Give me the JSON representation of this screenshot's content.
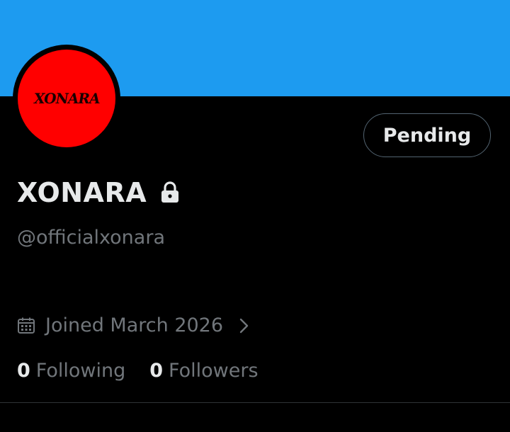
{
  "profile": {
    "avatar_logo_text": "XONARA",
    "display_name": "XONARA",
    "handle": "@officialxonara",
    "joined": "Joined March 2026",
    "follow_button_label": "Pending"
  },
  "stats": {
    "following_count": "0",
    "following_label": "Following",
    "followers_count": "0",
    "followers_label": "Followers"
  },
  "icons": {
    "lock": "lock-icon",
    "calendar": "calendar-icon",
    "chevron": "chevron-right-icon"
  },
  "colors": {
    "banner": "#1d9bf0",
    "avatar": "#ff0000",
    "background": "#000000",
    "primary_text": "#e7e9ea",
    "secondary_text": "#71767b",
    "border": "#536471"
  }
}
